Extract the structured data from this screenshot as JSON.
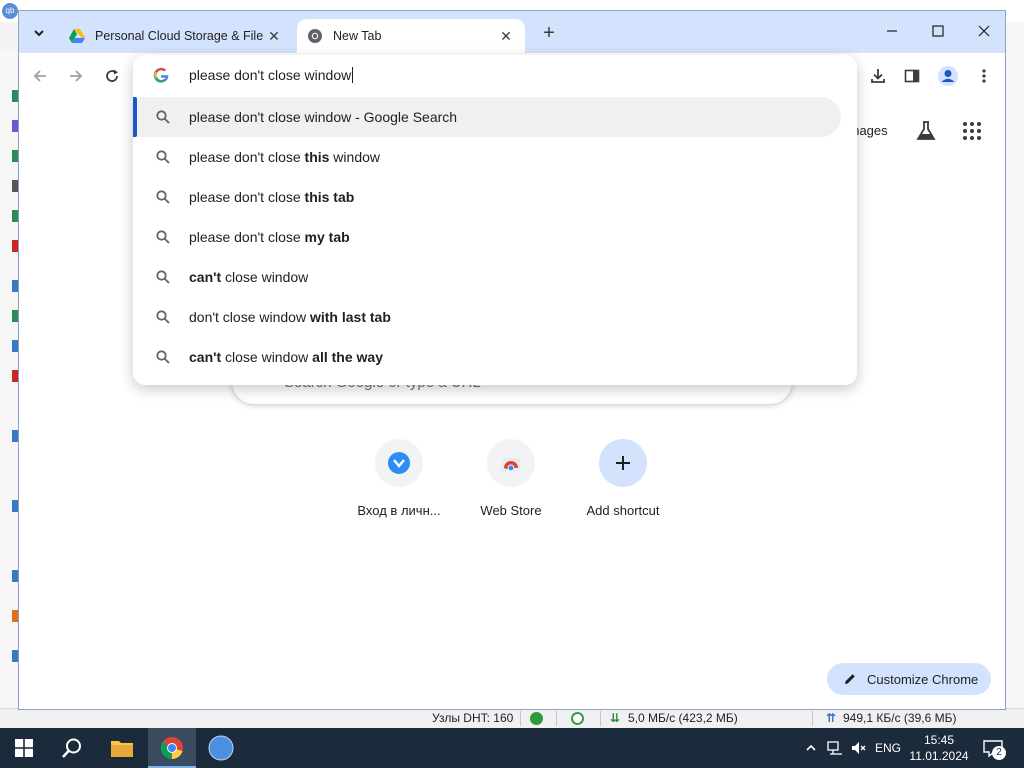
{
  "background_app": {
    "statusbar": {
      "dht": "Узлы DHT: 160",
      "download": "5,0 МБ/с (423,2 МБ)",
      "upload": "949,1 КБ/с (39,6 МБ)"
    }
  },
  "tabs": [
    {
      "title": "Personal Cloud Storage & File S",
      "icon": "google-drive-icon",
      "active": false
    },
    {
      "title": "New Tab",
      "icon": "chrome-icon",
      "active": true
    }
  ],
  "omnibox": {
    "input_value": "please don't close window",
    "suggestions": [
      {
        "plain": "please don't close window",
        "bold": "",
        "suffix": " - Google Search",
        "selected": true
      },
      {
        "plain": "please don't close ",
        "bold": "this",
        "suffix": " window",
        "selected": false
      },
      {
        "plain": "please don't close ",
        "bold": "this tab",
        "suffix": "",
        "selected": false
      },
      {
        "plain": "please don't close ",
        "bold": "my tab",
        "suffix": "",
        "selected": false
      },
      {
        "bold_first": "can't",
        "plain": " close window",
        "selected": false
      },
      {
        "plain": "don't close window ",
        "bold": "with last tab",
        "suffix": "",
        "selected": false
      },
      {
        "bold_first": "can't",
        "plain": " close window ",
        "bold": "all the way",
        "selected": false
      }
    ]
  },
  "ntp": {
    "images_link": "Images",
    "search_placeholder": "Search Google or type a URL",
    "shortcuts": [
      {
        "label": "Вход в личн...",
        "icon": "shield-v-icon"
      },
      {
        "label": "Web Store",
        "icon": "web-store-icon"
      },
      {
        "label": "Add shortcut",
        "icon": "plus-icon"
      }
    ],
    "customize_label": "Customize Chrome"
  },
  "taskbar": {
    "language": "ENG",
    "time": "15:45",
    "date": "11.01.2024",
    "notification_count": "2"
  },
  "colors": {
    "tabbar": "#d3e3fd",
    "selected_accent": "#1f55c9",
    "taskbar": "#1c2b3b"
  }
}
